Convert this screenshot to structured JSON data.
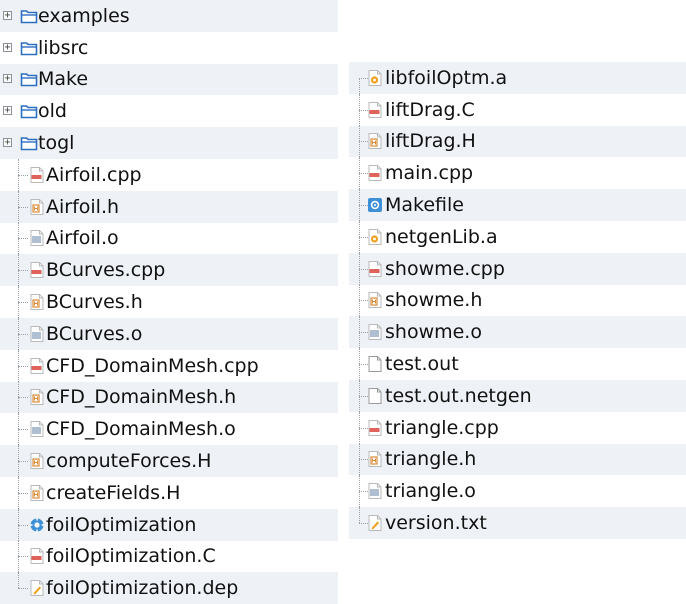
{
  "left_column": [
    {
      "type": "folder",
      "label": "examples",
      "icon": "folder-icon"
    },
    {
      "type": "folder",
      "label": "libsrc",
      "icon": "folder-icon"
    },
    {
      "type": "folder",
      "label": "Make",
      "icon": "folder-icon"
    },
    {
      "type": "folder",
      "label": "old",
      "icon": "folder-icon"
    },
    {
      "type": "folder",
      "label": "togl",
      "icon": "folder-icon"
    },
    {
      "type": "cpp",
      "label": "Airfoil.cpp",
      "icon": "cpp-file-icon"
    },
    {
      "type": "h",
      "label": "Airfoil.h",
      "icon": "header-file-icon"
    },
    {
      "type": "o",
      "label": "Airfoil.o",
      "icon": "object-file-icon"
    },
    {
      "type": "cpp",
      "label": "BCurves.cpp",
      "icon": "cpp-file-icon"
    },
    {
      "type": "h",
      "label": "BCurves.h",
      "icon": "header-file-icon"
    },
    {
      "type": "o",
      "label": "BCurves.o",
      "icon": "object-file-icon"
    },
    {
      "type": "cpp",
      "label": "CFD_DomainMesh.cpp",
      "icon": "cpp-file-icon"
    },
    {
      "type": "h",
      "label": "CFD_DomainMesh.h",
      "icon": "header-file-icon"
    },
    {
      "type": "o",
      "label": "CFD_DomainMesh.o",
      "icon": "object-file-icon"
    },
    {
      "type": "h",
      "label": "computeForces.H",
      "icon": "header-file-icon"
    },
    {
      "type": "h",
      "label": "createFields.H",
      "icon": "header-file-icon"
    },
    {
      "type": "exe",
      "label": "foilOptimization",
      "icon": "executable-icon"
    },
    {
      "type": "cpp",
      "label": "foilOptimization.C",
      "icon": "cpp-file-icon"
    },
    {
      "type": "txt",
      "label": "foilOptimization.dep",
      "icon": "text-file-icon"
    }
  ],
  "right_column": [
    {
      "type": "lib",
      "label": "libfoilOptm.a",
      "icon": "library-file-icon"
    },
    {
      "type": "cpp",
      "label": "liftDrag.C",
      "icon": "cpp-file-icon"
    },
    {
      "type": "h",
      "label": "liftDrag.H",
      "icon": "header-file-icon"
    },
    {
      "type": "cpp",
      "label": "main.cpp",
      "icon": "cpp-file-icon"
    },
    {
      "type": "make",
      "label": "Makefile",
      "icon": "makefile-icon"
    },
    {
      "type": "lib",
      "label": "netgenLib.a",
      "icon": "library-file-icon"
    },
    {
      "type": "cpp",
      "label": "showme.cpp",
      "icon": "cpp-file-icon"
    },
    {
      "type": "h",
      "label": "showme.h",
      "icon": "header-file-icon"
    },
    {
      "type": "o",
      "label": "showme.o",
      "icon": "object-file-icon"
    },
    {
      "type": "plain",
      "label": "test.out",
      "icon": "plain-file-icon"
    },
    {
      "type": "plain",
      "label": "test.out.netgen",
      "icon": "plain-file-icon"
    },
    {
      "type": "cpp",
      "label": "triangle.cpp",
      "icon": "cpp-file-icon"
    },
    {
      "type": "h",
      "label": "triangle.h",
      "icon": "header-file-icon"
    },
    {
      "type": "o",
      "label": "triangle.o",
      "icon": "object-file-icon"
    },
    {
      "type": "txt",
      "label": "version.txt",
      "icon": "text-file-icon"
    }
  ],
  "expander_symbol": "+",
  "colors": {
    "row_shade": "#eef1f6",
    "folder_blue": "#2f6fc0",
    "cpp_red": "#d9463e",
    "header_orange": "#d98b3a",
    "object_gray": "#8ea2bf",
    "exe_blue": "#3d8fd8",
    "lib_orange": "#f0a020"
  }
}
